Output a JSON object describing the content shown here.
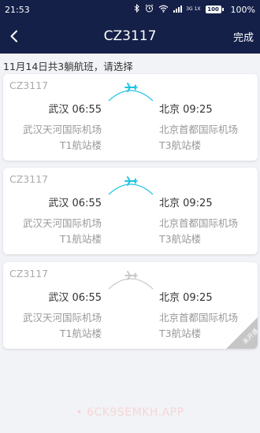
{
  "status_bar": {
    "time": "21:53",
    "battery_level": "100",
    "battery_percent": "100%",
    "signal_label": "3G 1X"
  },
  "nav": {
    "title": "CZ3117",
    "done_label": "完成"
  },
  "summary": "11月14日共3躺航班，请选择",
  "flights": [
    {
      "flight_no": "CZ3117",
      "dep_time": "武汉 06:55",
      "arr_time": "北京 09:25",
      "dep_airport": "武汉天河国际机场",
      "arr_airport": "北京首都国际机场",
      "dep_terminal": "T1航站楼",
      "arr_terminal": "T3航站楼",
      "status": "active",
      "tag": ""
    },
    {
      "flight_no": "CZ3117",
      "dep_time": "武汉 06:55",
      "arr_time": "北京 09:25",
      "dep_airport": "武汉天河国际机场",
      "arr_airport": "北京首都国际机场",
      "dep_terminal": "T1航站楼",
      "arr_terminal": "T3航站楼",
      "status": "active",
      "tag": ""
    },
    {
      "flight_no": "CZ3117",
      "dep_time": "武汉 06:55",
      "arr_time": "北京 09:25",
      "dep_airport": "武汉天河国际机场",
      "arr_airport": "北京首都国际机场",
      "dep_terminal": "T1航站楼",
      "arr_terminal": "T3航站楼",
      "status": "inactive",
      "tag": "未开通"
    }
  ],
  "watermark": "• 6CK9SEMKH.APP",
  "colors": {
    "header_bg": "#142048",
    "page_bg": "#f2f3f7",
    "route_active": "#1ec3e6",
    "route_inactive": "#c8c8c8",
    "tag_bg": "#c6c6c6"
  },
  "icons": {
    "back": "chevron-left-icon",
    "route": "airplane-icon",
    "bluetooth": "bluetooth-icon",
    "alarm": "alarm-clock-icon",
    "wifi": "wifi-icon",
    "signal": "signal-icon",
    "battery": "battery-icon"
  }
}
